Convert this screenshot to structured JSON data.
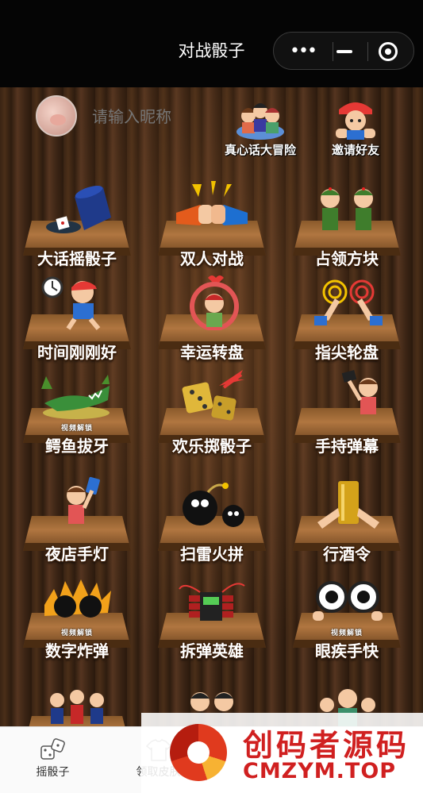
{
  "header": {
    "title": "对战骰子"
  },
  "capsule": {
    "more_glyph": "•••"
  },
  "profile": {
    "nickname_placeholder": "请输入昵称"
  },
  "top_actions": [
    {
      "label": "真心话大冒险",
      "icon": "truth-or-dare-icon"
    },
    {
      "label": "邀请好友",
      "icon": "invite-friend-icon"
    }
  ],
  "games": [
    {
      "label": "大话摇骰子",
      "icon": "dice-cup-icon"
    },
    {
      "label": "双人对战",
      "icon": "fist-bump-icon"
    },
    {
      "label": "占领方块",
      "icon": "soldiers-icon"
    },
    {
      "label": "时间刚刚好",
      "icon": "clock-boy-icon"
    },
    {
      "label": "幸运转盘",
      "icon": "roulette-icon"
    },
    {
      "label": "指尖轮盘",
      "icon": "finger-tap-icon"
    },
    {
      "label": "鳄鱼拔牙",
      "icon": "crocodile-icon",
      "badge": "视频解锁"
    },
    {
      "label": "欢乐掷骰子",
      "icon": "golden-dice-icon"
    },
    {
      "label": "手持弹幕",
      "icon": "card-boy-icon"
    },
    {
      "label": "夜店手灯",
      "icon": "phone-light-icon"
    },
    {
      "label": "扫雷火拼",
      "icon": "bomb-icon"
    },
    {
      "label": "行酒令",
      "icon": "wine-glass-icon"
    },
    {
      "label": "数字炸弹",
      "icon": "number-bomb-icon",
      "badge": "视频解锁"
    },
    {
      "label": "拆弹英雄",
      "icon": "dynamite-icon"
    },
    {
      "label": "眼疾手快",
      "icon": "eyes-icon",
      "badge": "视频解锁"
    }
  ],
  "tabs": [
    {
      "label": "摇骰子",
      "icon": "dice-icon"
    },
    {
      "label": "领取皮肤",
      "icon": "shirt-icon"
    }
  ],
  "watermark": {
    "cn": "创码者源码",
    "en": "CMZYM.TOP"
  },
  "colors": {
    "title_bar": "#050505",
    "label_outline": "#3a1d08",
    "plank": "#b07640",
    "watermark_red": "#d02020"
  }
}
